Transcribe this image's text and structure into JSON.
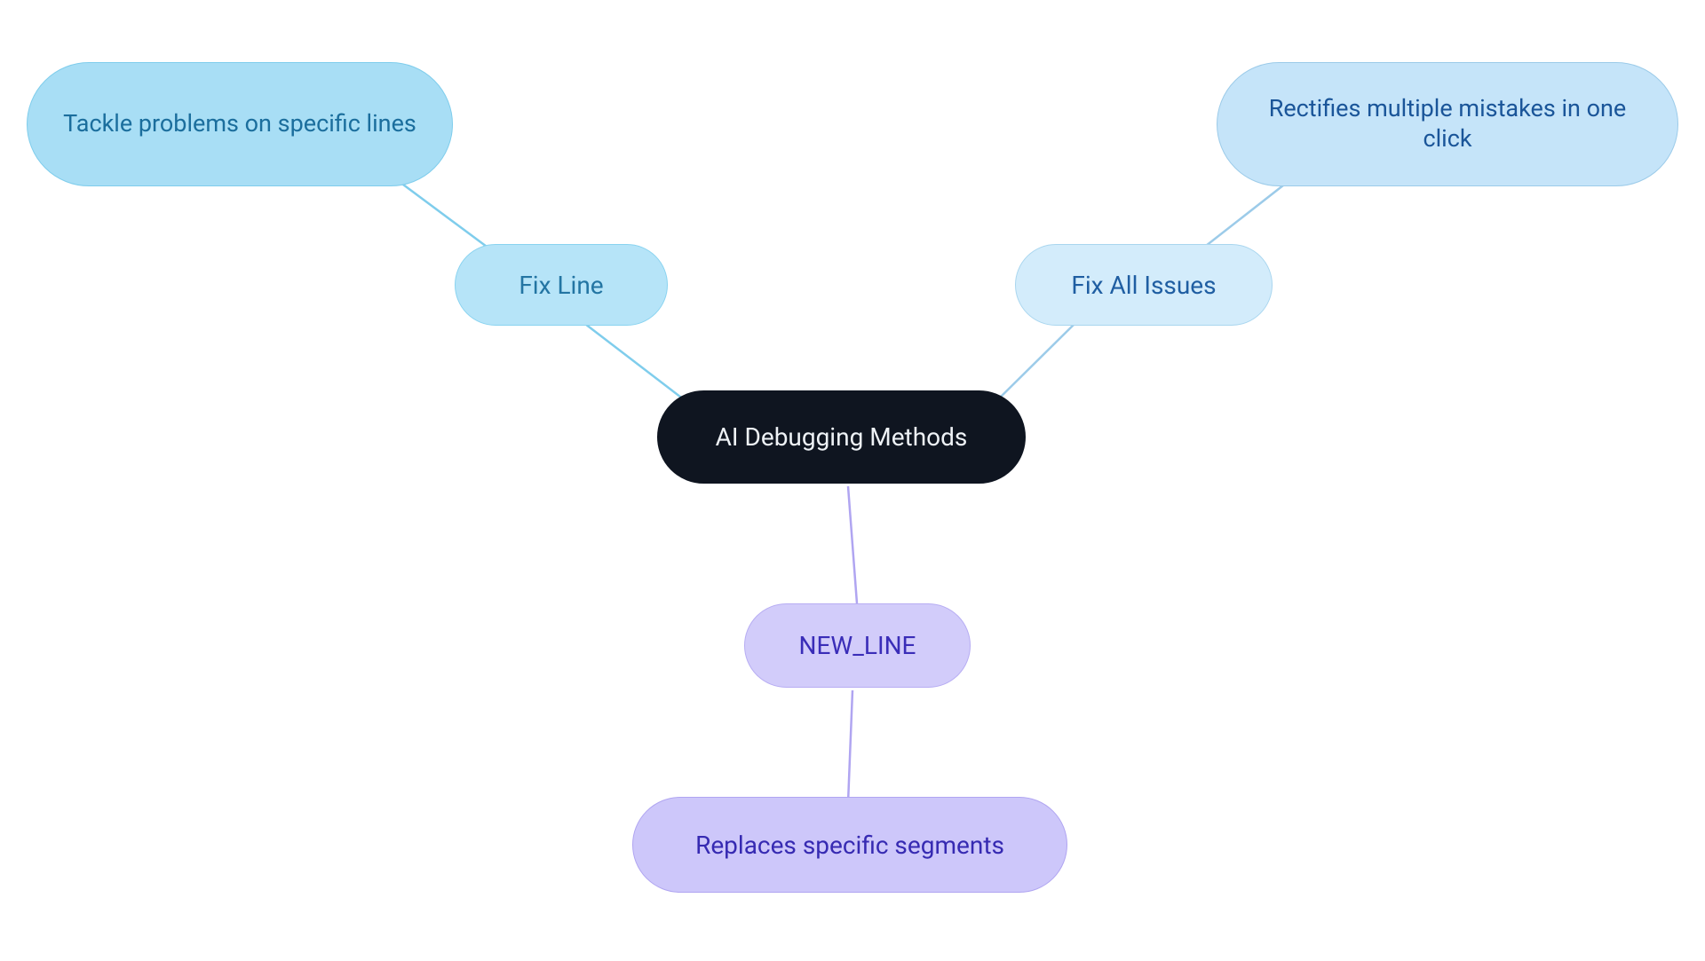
{
  "root": {
    "label": "AI Debugging Methods"
  },
  "branches": {
    "fix_line": {
      "label": "Fix Line",
      "leaf": "Tackle problems on specific lines"
    },
    "fix_all": {
      "label": "Fix All Issues",
      "leaf": "Rectifies multiple mistakes in one click"
    },
    "new_line": {
      "label": "NEW_LINE",
      "leaf": "Replaces specific segments"
    }
  },
  "colors": {
    "root_bg": "#0f1520",
    "root_fg": "#eef2f6",
    "fixline_bg": "#b6e4f8",
    "fixline_fg": "#2375a3",
    "fixall_bg": "#d3ecfb",
    "fixall_fg": "#1f5ea2",
    "newline_bg": "#d2ccfa",
    "newline_fg": "#3a2db8",
    "edge_fixline": "#7fcdec",
    "edge_fixall": "#9ccbe9",
    "edge_newline": "#b0a5f1"
  }
}
